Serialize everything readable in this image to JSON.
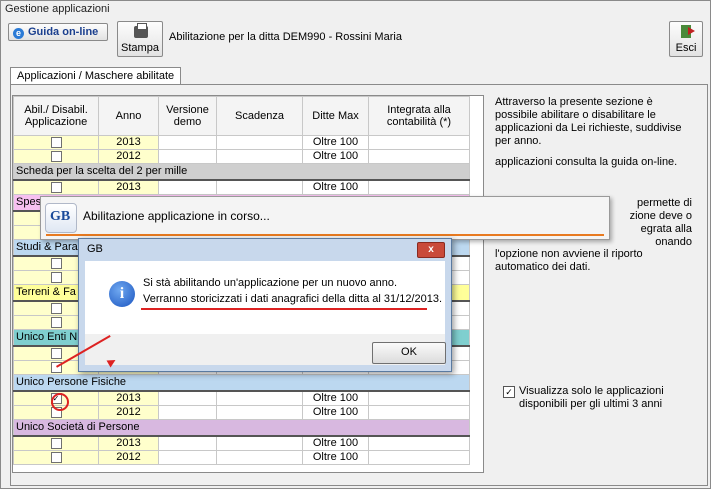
{
  "window": {
    "title": "Gestione applicazioni"
  },
  "toolbar": {
    "guida_label": "Guida on-line",
    "stampa_label": "Stampa",
    "esci_label": "Esci",
    "header_text": "Abilitazione per la ditta DEM990 -  Rossini Maria"
  },
  "tab": {
    "label": "Applicazioni / Maschere abilitate"
  },
  "grid": {
    "headers": {
      "abil": "Abil./ Disabil. Applicazione",
      "anno": "Anno",
      "versione": "Versione demo",
      "scadenza": "Scadenza",
      "ditte": "Ditte Max",
      "integrata": "Integrata alla contabilità (*)"
    },
    "rows": [
      {
        "type": "row",
        "anno": "2013",
        "ditte": "Oltre 100"
      },
      {
        "type": "row",
        "anno": "2012",
        "ditte": "Oltre 100"
      },
      {
        "type": "group",
        "label": "Scheda per la scelta del 2 per mille",
        "color": "#cfcfcf"
      },
      {
        "type": "row",
        "anno": "2013",
        "ditte": "Oltre 100"
      },
      {
        "type": "group",
        "label": "Spes",
        "color": "#f7c0f0"
      },
      {
        "type": "row",
        "anno": "",
        "ditte": ""
      },
      {
        "type": "row",
        "anno": "",
        "ditte": ""
      },
      {
        "type": "group",
        "label": "Studi & Para",
        "color": "#bcd8f0"
      },
      {
        "type": "row",
        "anno": "",
        "ditte": ""
      },
      {
        "type": "row",
        "anno": "",
        "ditte": ""
      },
      {
        "type": "group",
        "label": "Terreni & Fa",
        "color": "#ffff99"
      },
      {
        "type": "row",
        "anno": "",
        "ditte": ""
      },
      {
        "type": "row",
        "anno": "",
        "ditte": ""
      },
      {
        "type": "group",
        "label": "Unico Enti N",
        "color": "#7fcfcf"
      },
      {
        "type": "row",
        "anno": "",
        "ditte": ""
      },
      {
        "type": "row",
        "anno": "",
        "ditte": ""
      },
      {
        "type": "group",
        "label": "Unico Persone Fisiche",
        "color": "#bcd8f0"
      },
      {
        "type": "row",
        "anno": "2013",
        "ditte": "Oltre 100",
        "checked": true
      },
      {
        "type": "row",
        "anno": "2012",
        "ditte": "Oltre 100"
      },
      {
        "type": "group",
        "label": "Unico Società di Persone",
        "color": "#d8b8e0"
      },
      {
        "type": "row",
        "anno": "2013",
        "ditte": "Oltre 100"
      },
      {
        "type": "row",
        "anno": "2012",
        "ditte": "Oltre 100"
      }
    ]
  },
  "info": {
    "p1": "Attraverso la presente sezione è possibile abilitare o disabilitare le applicazioni da Lei richieste, suddivise per anno.",
    "p2": "applicazioni consulta la guida on-line.",
    "p3": "permette di\nzione deve o\negrata alla\nonando",
    "p4": "l'opzione non avviene il riporto automatico dei dati."
  },
  "visualizza": {
    "label": "Visualizza solo le applicazioni disponibili per gli ultimi 3 anni",
    "checked": true
  },
  "progress": {
    "logo": "GB",
    "text": "Abilitazione applicazione in corso..."
  },
  "dialog": {
    "title": "GB",
    "close": "x",
    "line1": "Si stà abilitando un'applicazione per un nuovo anno.",
    "line2": "Verranno storicizzati i dati anagrafici della ditta al 31/12/2013.",
    "ok": "OK"
  }
}
